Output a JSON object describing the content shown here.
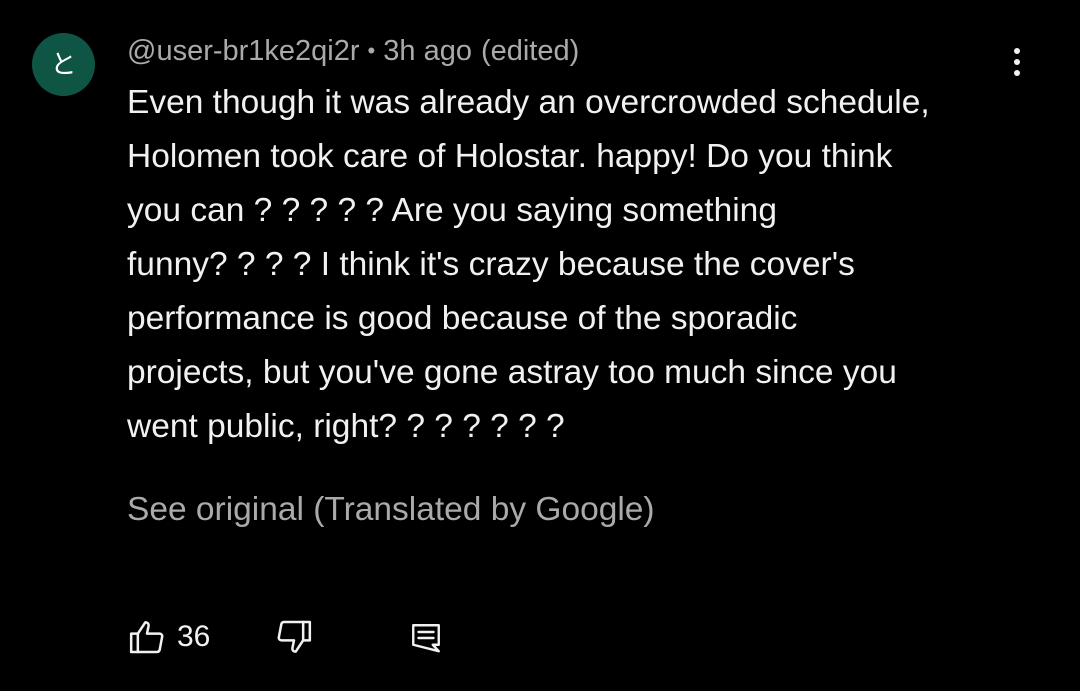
{
  "comment": {
    "avatar": {
      "initial": "と",
      "color": "#0f5546"
    },
    "author": "@user-br1ke2qi2r",
    "separator": "•",
    "timestamp": "3h ago",
    "edited_label": "(edited)",
    "text_lines": [
      "Even though it was already an overcrowded schedule,",
      "Holomen took care of Holostar. happy! Do you think",
      "you can ? ? ? ? ? Are you saying something",
      "funny? ? ? ? I think it's crazy because the cover's",
      "performance is good because of the sporadic",
      "projects, but you've gone astray too much since you",
      "went public, right? ? ? ? ? ? ?"
    ],
    "see_original_label": "See original (Translated by Google)",
    "like_count": "36",
    "icons": {
      "more": "more-vert-icon",
      "like": "thumbs-up-icon",
      "dislike": "thumbs-down-icon",
      "reply": "reply-comment-icon"
    }
  },
  "colors": {
    "background": "#000000",
    "primary_text": "#f1f1f1",
    "secondary_text": "#aaaaaa"
  }
}
